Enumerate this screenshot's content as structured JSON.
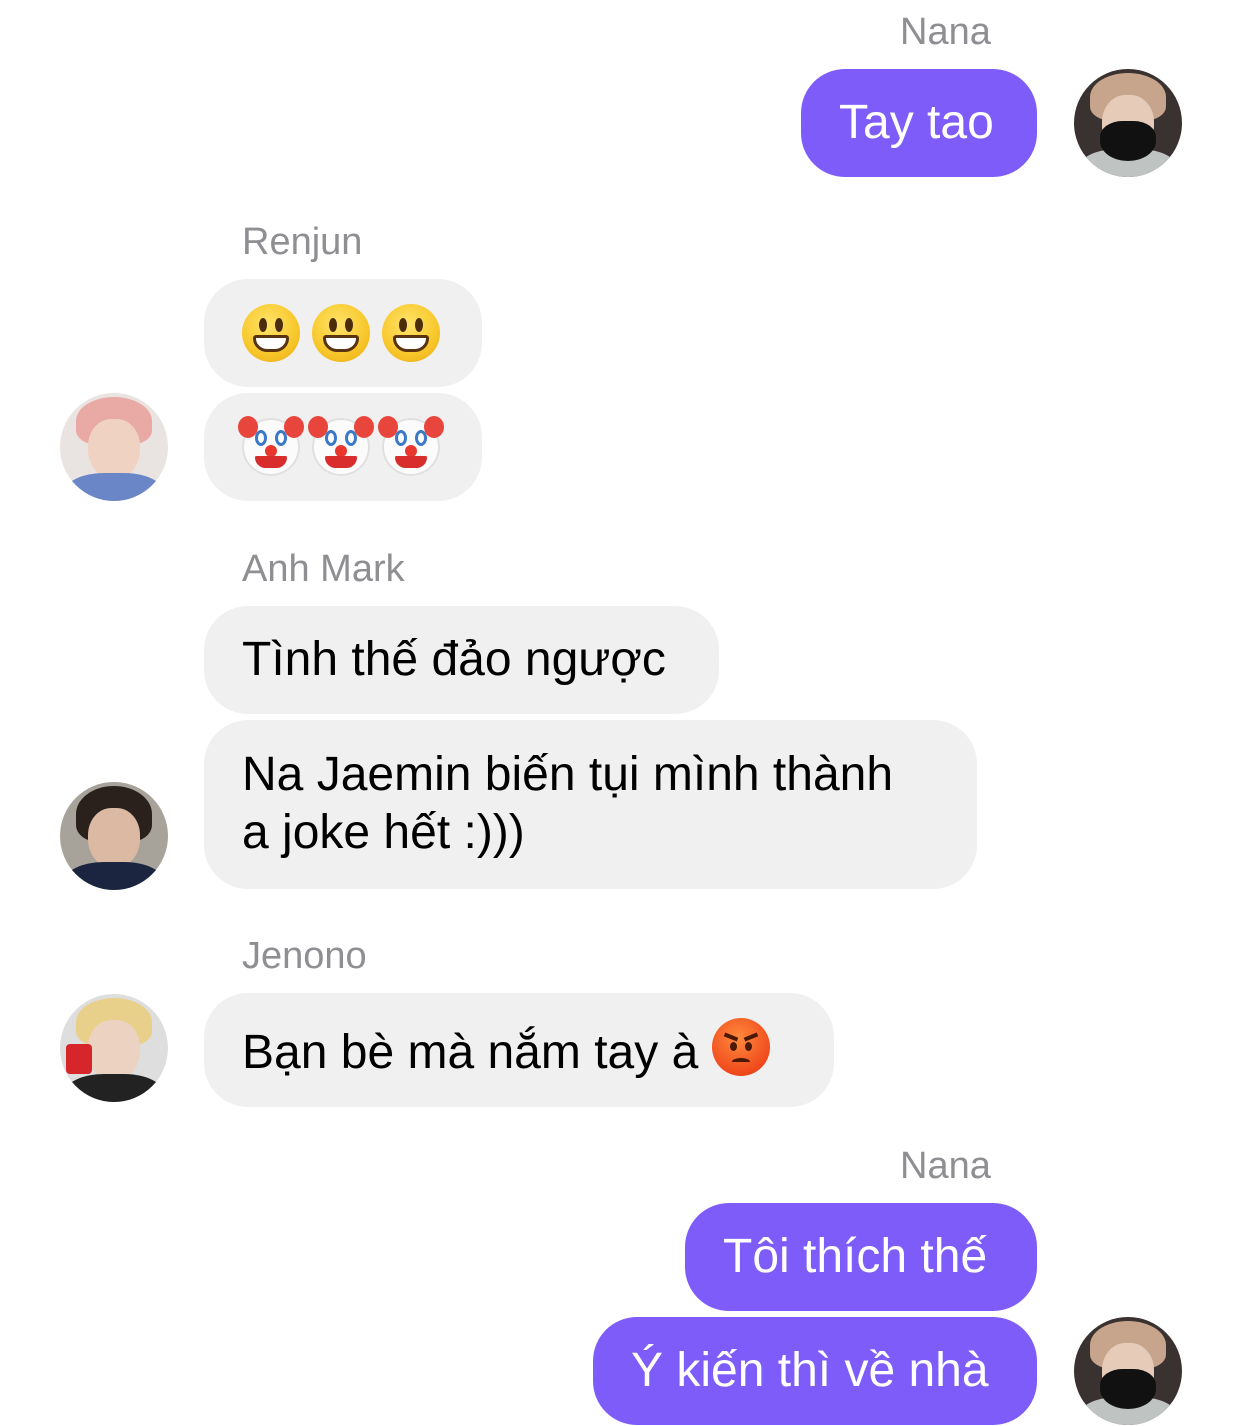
{
  "colors": {
    "outgoing_bubble": "#7d5cfa",
    "incoming_bubble": "#f0f0f0",
    "sender_name": "#8e8e93"
  },
  "messages": [
    {
      "sender": "Nana",
      "direction": "outgoing",
      "texts": [
        "Tay tao"
      ]
    },
    {
      "sender": "Renjun",
      "direction": "incoming",
      "emoji_rows": [
        [
          "grinning-face",
          "grinning-face",
          "grinning-face"
        ],
        [
          "clown-face",
          "clown-face",
          "clown-face"
        ]
      ]
    },
    {
      "sender": "Anh Mark",
      "direction": "incoming",
      "texts": [
        "Tình thế đảo ngược",
        "Na Jaemin biến tụi mình thành a joke hết :)))"
      ]
    },
    {
      "sender": "Jenono",
      "direction": "incoming",
      "texts": [
        "Bạn bè mà nắm tay à"
      ],
      "trailing_emoji": "angry-face"
    },
    {
      "sender": "Nana",
      "direction": "outgoing",
      "texts": [
        "Tôi thích thế",
        "Ý kiến thì về nhà"
      ]
    }
  ],
  "chat": {
    "m1": {
      "sender": "Nana",
      "text": "Tay tao"
    },
    "m2": {
      "sender": "Renjun"
    },
    "m3": {
      "sender": "Anh Mark",
      "text1": "Tình thế đảo ngược",
      "text2_line1": "Na Jaemin biến tụi mình thành",
      "text2_line2": "a joke hết :)))"
    },
    "m4": {
      "sender": "Jenono",
      "text": "Bạn bè mà nắm tay à"
    },
    "m5": {
      "sender": "Nana",
      "text1": "Tôi thích thế",
      "text2": "Ý kiến thì về nhà"
    }
  }
}
